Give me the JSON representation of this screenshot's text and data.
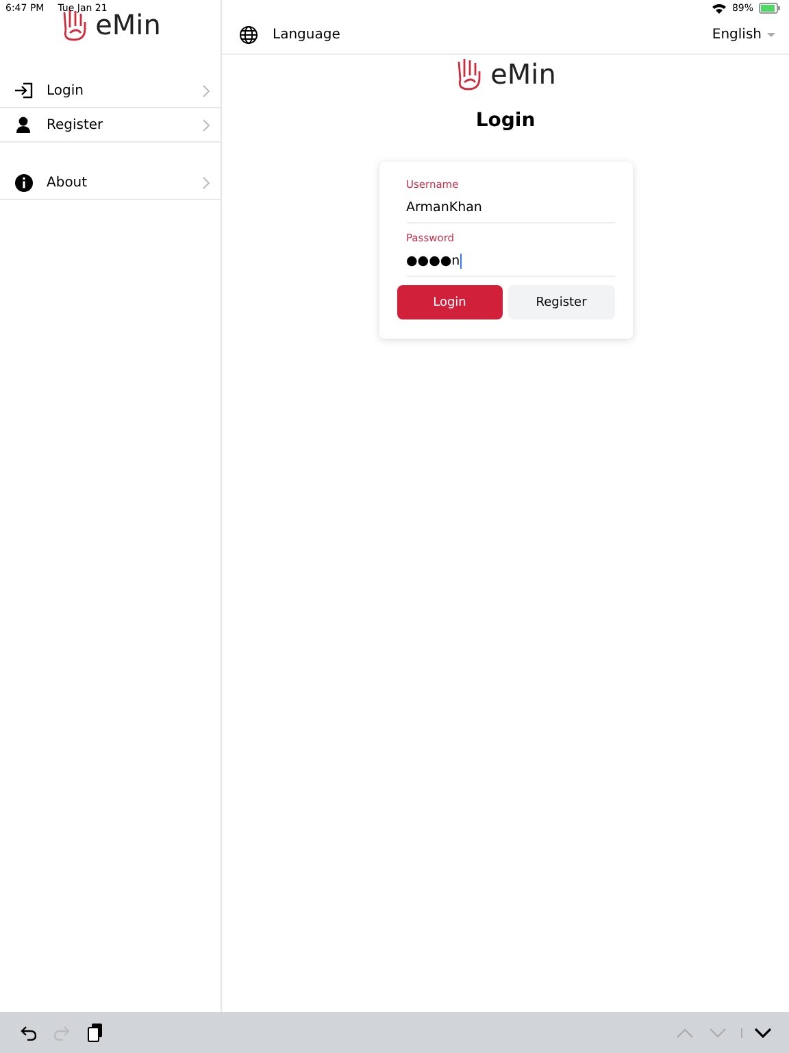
{
  "status_bar": {
    "time": "6:47 PM",
    "date": "Tue Jan 21",
    "battery": "89%"
  },
  "sidebar": {
    "logo": "eMin",
    "items": [
      {
        "label": "Login",
        "kind": "login"
      },
      {
        "label": "Register",
        "kind": "register"
      },
      {
        "label": "About",
        "kind": "about"
      }
    ]
  },
  "language_bar": {
    "label": "Language",
    "value": "English"
  },
  "main": {
    "logo": "eMin",
    "title": "Login"
  },
  "form": {
    "fields": [
      {
        "label": "Username",
        "value": "ArmanKhan"
      },
      {
        "label": "Password",
        "value": "●●●●n"
      }
    ],
    "buttons": [
      {
        "label": "Login",
        "kind": "primary"
      },
      {
        "label": "Register",
        "kind": "secondary"
      }
    ]
  },
  "keyboard_toolbar": {
    "items": [
      {
        "kind": "undo",
        "disabled": false
      },
      {
        "kind": "redo",
        "disabled": true
      },
      {
        "kind": "paste",
        "disabled": false
      }
    ],
    "nav": [
      {
        "kind": "up",
        "disabled": true
      },
      {
        "kind": "down",
        "disabled": true
      },
      {
        "kind": "dismiss",
        "disabled": false
      }
    ]
  }
}
